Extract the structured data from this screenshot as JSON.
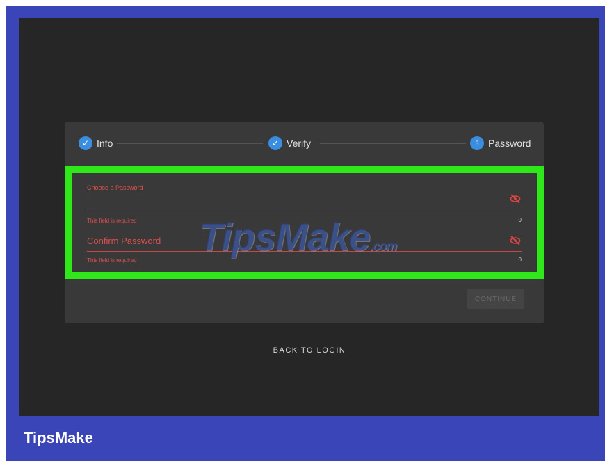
{
  "stepper": {
    "steps": [
      {
        "label": "Info",
        "state": "complete"
      },
      {
        "label": "Verify",
        "state": "complete"
      },
      {
        "label": "Password",
        "state": "active",
        "number": "3"
      }
    ]
  },
  "form": {
    "password": {
      "label": "Choose a Password",
      "value": "|",
      "helper": "This field is required",
      "counter": "0",
      "icon": "eye-off-icon"
    },
    "confirm": {
      "label": "Confirm Password",
      "value": "",
      "helper": "This field is required",
      "counter": "0",
      "icon": "eye-off-icon"
    },
    "continue_label": "CONTINUE"
  },
  "back_to_login": "BACK TO LOGIN",
  "watermark": {
    "main": "TipsMake",
    "suffix": ".com"
  },
  "brand": "TipsMake",
  "colors": {
    "frame": "#3a45b8",
    "screen": "#262626",
    "card": "#393939",
    "highlight": "#2ee81a",
    "error": "#e05050",
    "step_circle": "#3b8de0"
  }
}
